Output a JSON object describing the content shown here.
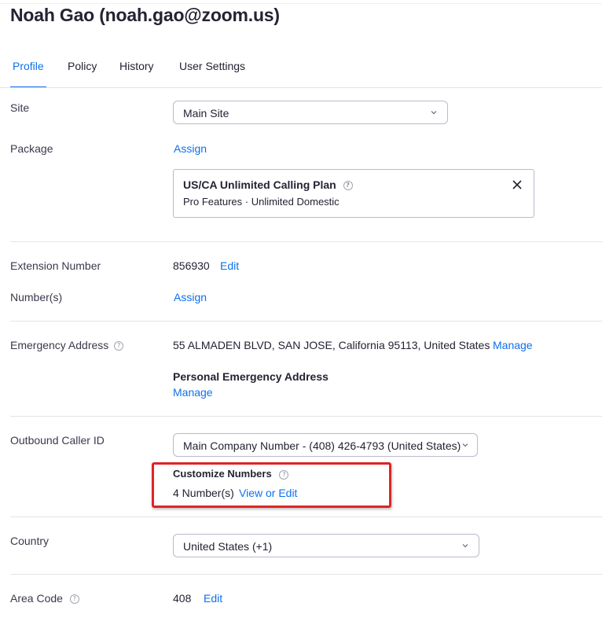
{
  "header": {
    "title": "Noah Gao (noah.gao@zoom.us)"
  },
  "tabs": [
    {
      "label": "Profile"
    },
    {
      "label": "Policy"
    },
    {
      "label": "History"
    },
    {
      "label": "User Settings"
    }
  ],
  "site": {
    "label": "Site",
    "value": "Main Site"
  },
  "package": {
    "label": "Package",
    "assign_link": "Assign",
    "plan_name": "US/CA Unlimited Calling Plan",
    "plan_features": "Pro Features · Unlimited Domestic"
  },
  "extension": {
    "label": "Extension Number",
    "value": "856930",
    "edit_link": "Edit"
  },
  "numbers": {
    "label": "Number(s)",
    "assign_link": "Assign"
  },
  "emergency": {
    "label": "Emergency Address",
    "address": "55 ALMADEN BLVD, SAN JOSE, California 95113, United States",
    "manage_link": "Manage",
    "personal_label": "Personal Emergency Address",
    "personal_manage_link": "Manage"
  },
  "outbound": {
    "label": "Outbound Caller ID",
    "value": "Main Company Number - (408) 426-4793 (United States)",
    "customize_label": "Customize Numbers",
    "count_text": "4 Number(s)",
    "view_edit_link": "View or Edit"
  },
  "country": {
    "label": "Country",
    "value": "United States (+1)"
  },
  "area_code": {
    "label": "Area Code",
    "value": "408",
    "edit_link": "Edit"
  },
  "icons": {
    "help": "question-circle-icon",
    "close": "close-icon",
    "chevron": "chevron-down-icon"
  },
  "colors": {
    "accent": "#0e71eb",
    "highlight": "#e02424",
    "text": "#232333"
  }
}
